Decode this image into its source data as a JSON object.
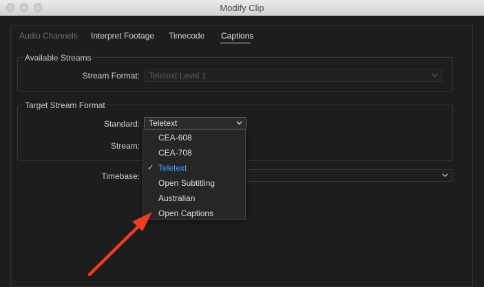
{
  "window": {
    "title": "Modify Clip"
  },
  "tabs": [
    {
      "label": "Audio Channels",
      "state": "disabled"
    },
    {
      "label": "Interpret Footage",
      "state": "normal"
    },
    {
      "label": "Timecode",
      "state": "normal"
    },
    {
      "label": "Captions",
      "state": "active"
    }
  ],
  "available_streams": {
    "group_label": "Available Streams",
    "stream_format_label": "Stream Format:",
    "stream_format_value": "Teletext Level 1"
  },
  "target_stream_format": {
    "group_label": "Target Stream Format",
    "standard_label": "Standard:",
    "standard_value": "Teletext",
    "stream_label": "Stream:"
  },
  "timebase": {
    "label": "Timebase:"
  },
  "standard_menu": {
    "items": [
      {
        "label": "CEA-608",
        "selected": false
      },
      {
        "label": "CEA-708",
        "selected": false
      },
      {
        "label": "Teletext",
        "selected": true
      },
      {
        "label": "Open Subtitling",
        "selected": false
      },
      {
        "label": "Australian",
        "selected": false
      },
      {
        "label": "Open Captions",
        "selected": false
      }
    ]
  },
  "annotation": {
    "arrow_color": "#f03a22"
  },
  "colors": {
    "selected_item": "#3ea2ff",
    "background": "#1d1d1d"
  }
}
